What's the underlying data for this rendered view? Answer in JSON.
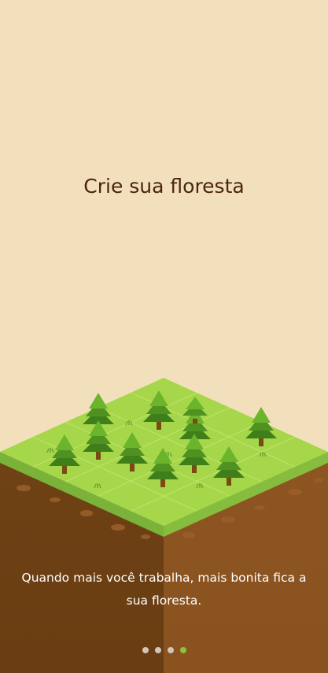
{
  "screen": {
    "title": "Crie sua floresta",
    "subtitle": "Quando mais você trabalha, mais bonita fica a sua floresta."
  },
  "pager": {
    "pages": [
      "page-1",
      "page-2",
      "page-3",
      "page-4"
    ],
    "active_page": 4
  },
  "illustration": {
    "image_name": "isometric-forest-island",
    "tree_count": 11,
    "colors": {
      "background": "#f2e0bd",
      "grass_top": "#a6d64a",
      "grass_light": "#b9e35b",
      "dirt_left": "#6b3f14",
      "dirt_right": "#8a5320",
      "tree_dark": "#3f7f1a",
      "tree_light": "#6cb42c",
      "trunk": "#7a4a14",
      "dot_active": "#8ac43a",
      "dot_inactive": "#cfc6bd"
    }
  }
}
